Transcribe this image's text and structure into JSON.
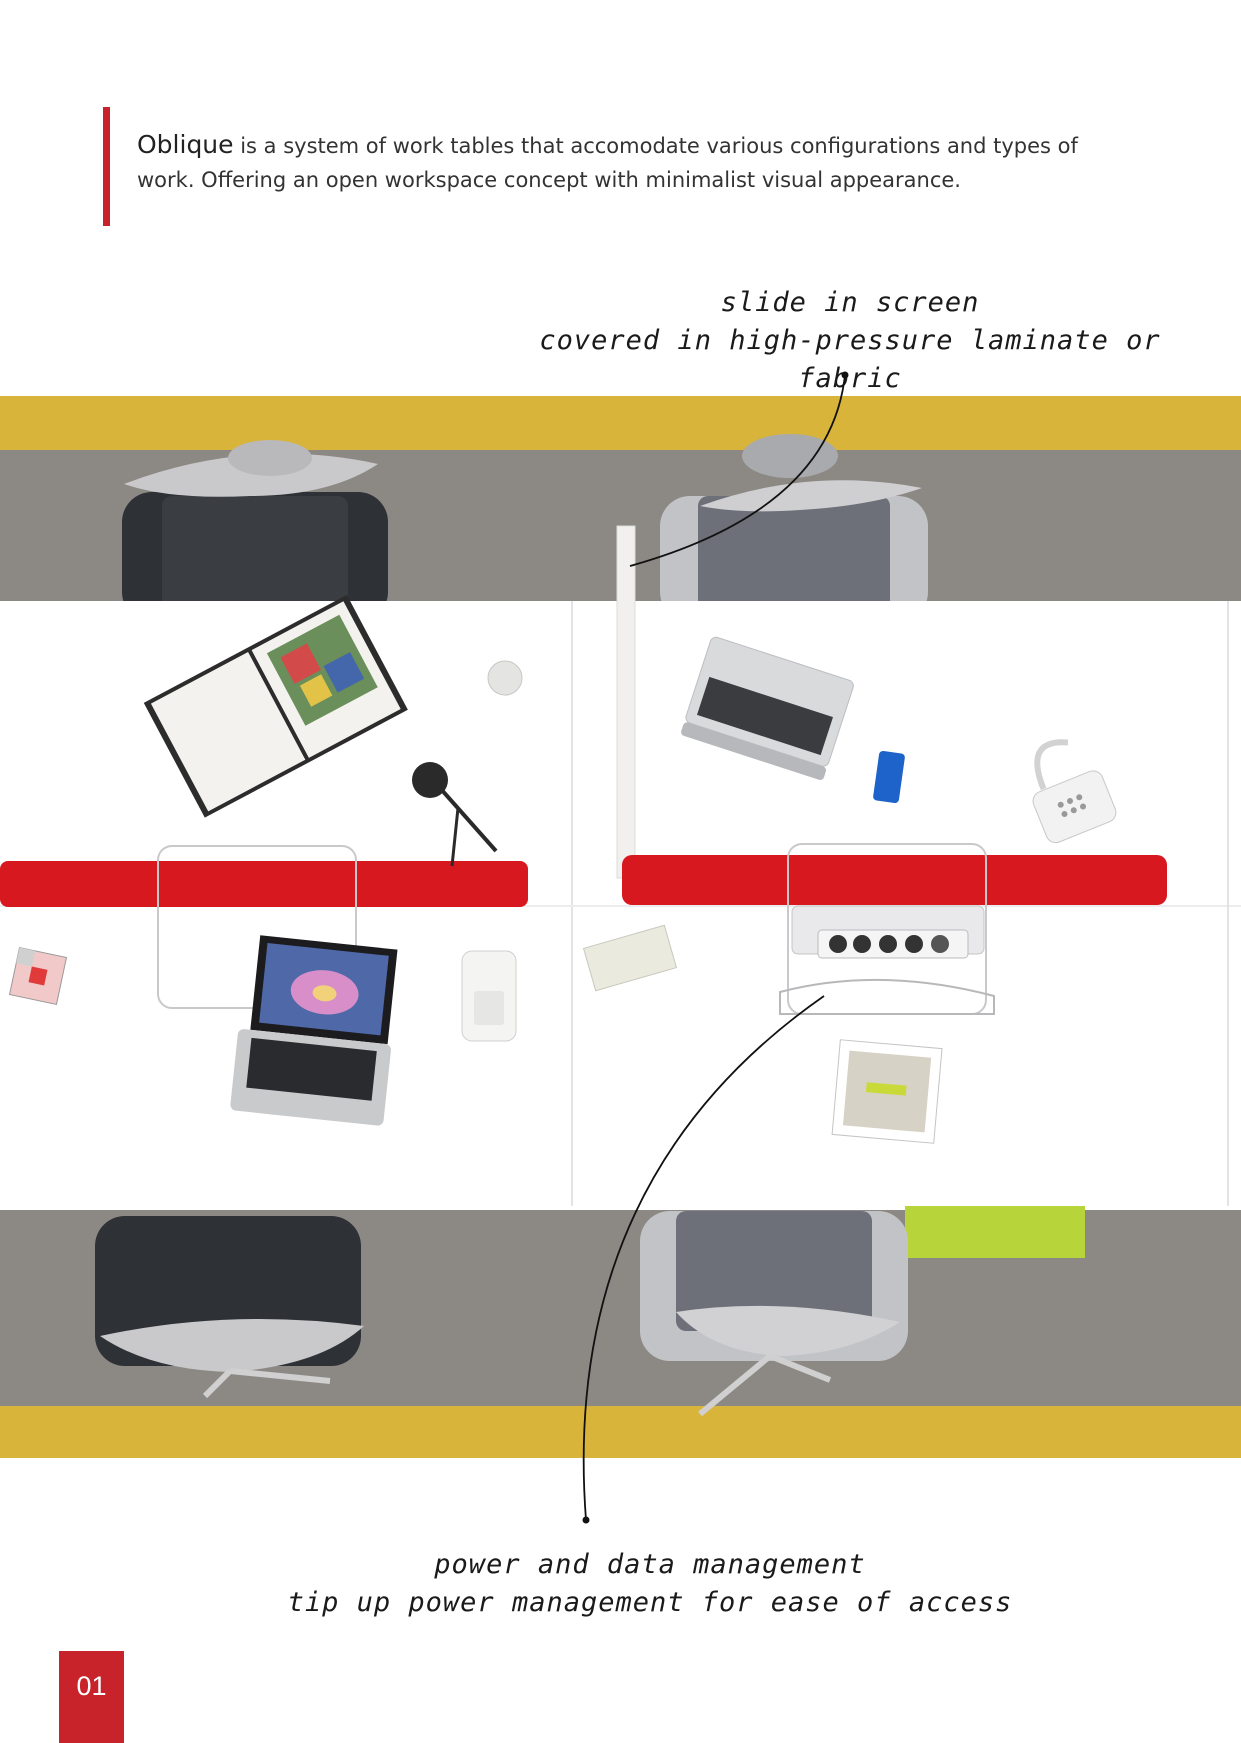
{
  "intro": {
    "lead": "Oblique",
    "text": " is a system of work tables that accomodate various configurations and types of work. Offering an open workspace concept with minimalist visual appearance."
  },
  "callouts": {
    "screen": {
      "line1": "slide in screen",
      "line2": "covered in high-pressure laminate or fabric"
    },
    "power": {
      "line1": "power and data management",
      "line2": "tip up power management for ease of access"
    }
  },
  "page_number": "01",
  "colors": {
    "accent_red": "#c8232a",
    "mustard": "#d9b43a",
    "carpet": "#8c8884",
    "desk": "#ffffff",
    "screen_red": "#d7191f",
    "lime": "#b7d43a"
  }
}
